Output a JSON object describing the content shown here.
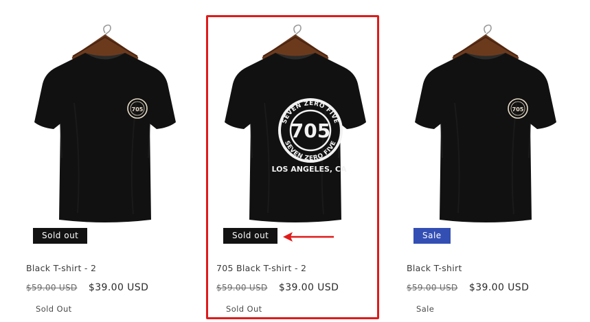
{
  "products": [
    {
      "title": "Black T-shirt - 2",
      "badge": "Sold out",
      "badge_type": "sold",
      "old_price": "$59.00 USD",
      "new_price": "$39.00 USD",
      "status": "Sold Out",
      "image": "shirt-front-logo-icon"
    },
    {
      "title": "705 Black T-shirt - 2",
      "badge": "Sold out",
      "badge_type": "sold",
      "old_price": "$59.00 USD",
      "new_price": "$39.00 USD",
      "status": "Sold Out",
      "image": "shirt-back-logo-icon",
      "print": {
        "top_text": "SEVEN ZERO FIVE",
        "center_text": "705",
        "bottom_text": "SEVEN ZERO FIVE",
        "location": "LOS ANGELES, CA"
      }
    },
    {
      "title": "Black T-shirt",
      "badge": "Sale",
      "badge_type": "sale",
      "old_price": "$59.00 USD",
      "new_price": "$39.00 USD",
      "status": "Sale",
      "image": "shirt-front-logo-icon"
    }
  ],
  "colors": {
    "sold_badge": "#121212",
    "sale_badge": "#334fb4",
    "highlight": "#e01a1a",
    "shirt": "#111111"
  }
}
